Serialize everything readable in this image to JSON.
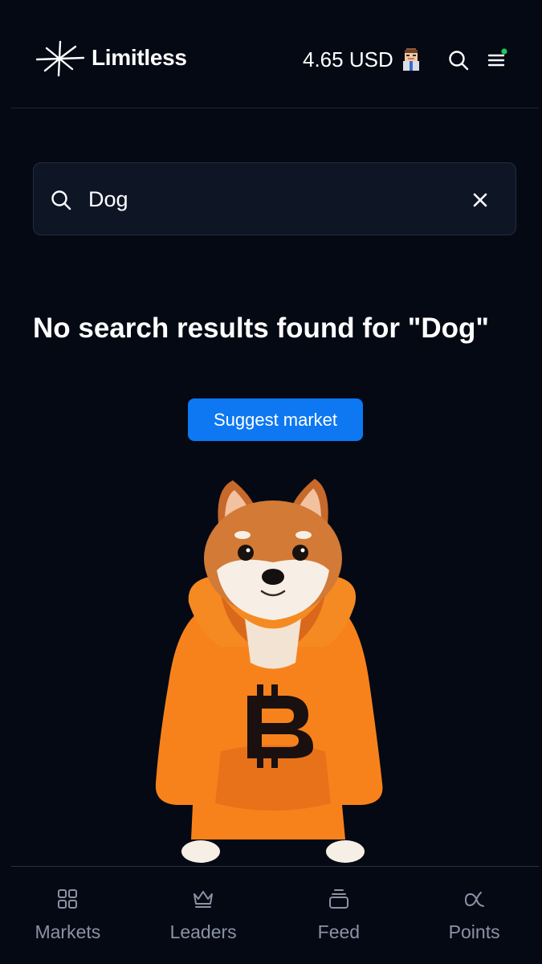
{
  "header": {
    "app_name": "Limitless",
    "balance": "4.65 USD",
    "logo_icon": "sparkle-logo-icon",
    "avatar_icon": "pixel-avatar-icon",
    "search_icon": "search-icon",
    "menu_icon": "hamburger-menu-icon",
    "notification_dot_color": "#22c55e"
  },
  "search": {
    "value": "Dog",
    "placeholder": "",
    "search_icon": "search-icon",
    "clear_icon": "close-icon"
  },
  "results": {
    "empty_message": "No search results found for \"Dog\"",
    "suggest_label": "Suggest market",
    "illustration": "shiba-dog-in-orange-bitcoin-hoodie"
  },
  "bottom_nav": {
    "items": [
      {
        "label": "Markets",
        "icon": "grid-icon"
      },
      {
        "label": "Leaders",
        "icon": "crown-icon"
      },
      {
        "label": "Feed",
        "icon": "stack-icon"
      },
      {
        "label": "Points",
        "icon": "alpha-icon"
      }
    ]
  },
  "colors": {
    "background": "#050914",
    "accent": "#0d78f2",
    "hoodie": "#f7821b",
    "nav_text": "#8a93a5"
  }
}
